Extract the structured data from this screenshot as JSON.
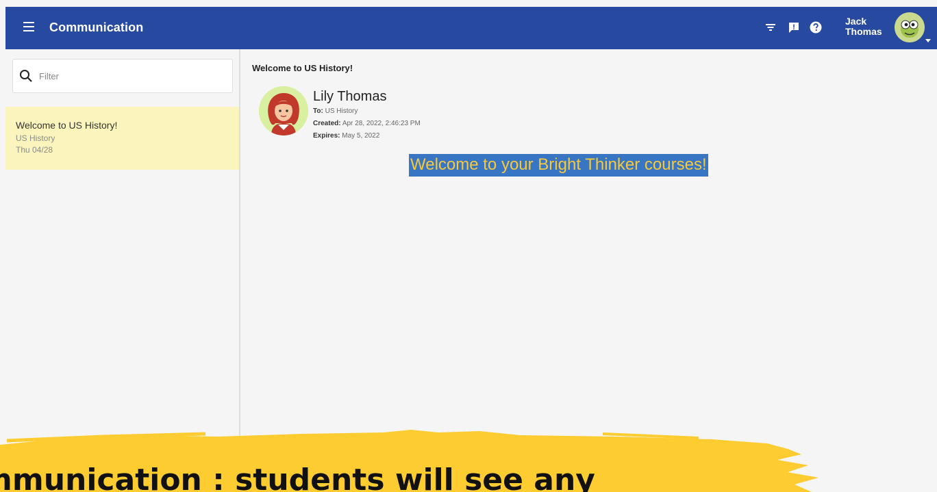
{
  "header": {
    "title": "Communication",
    "user_first": "Jack",
    "user_last": "Thomas",
    "brand_color": "#2749a0",
    "icons": [
      "menu-icon",
      "filter-icon",
      "feedback-icon",
      "help-icon",
      "avatar",
      "chevron-down-icon"
    ]
  },
  "sidebar": {
    "filter_placeholder": "Filter",
    "messages": [
      {
        "title": "Welcome to US History!",
        "course": "US History",
        "date": "Thu 04/28",
        "highlight_color": "#fbf5bd"
      }
    ]
  },
  "message": {
    "subject": "Welcome to US History!",
    "sender": "Lily Thomas",
    "to_label": "To:",
    "to": "US History",
    "created_label": "Created:",
    "created": "Apr 28, 2022, 2:46:23 PM",
    "expires_label": "Expires:",
    "expires": "May 5, 2022",
    "body": "Welcome to your Bright Thinker courses!",
    "body_bg": "#3875c3",
    "body_color": "#f7c93b"
  },
  "overlay": {
    "caption": "mmunication : students will see any",
    "brush_color": "#fdcc30"
  }
}
